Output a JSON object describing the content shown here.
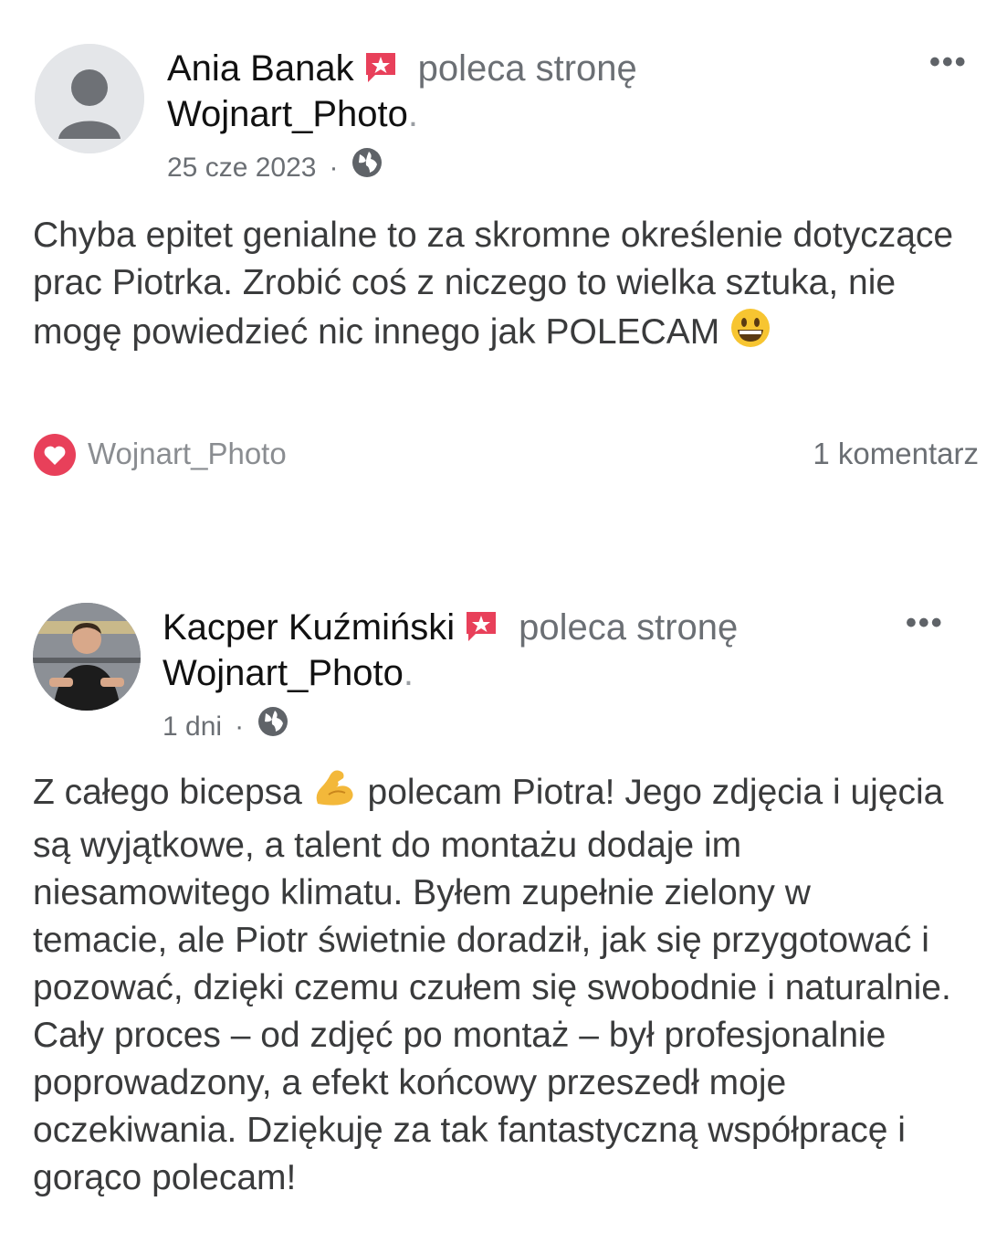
{
  "reviews": [
    {
      "author": "Ania Banak",
      "recommends_text": "poleca stronę",
      "page": "Wojnart_Photo",
      "period": ".",
      "date": "25 cze 2023",
      "separator": "·",
      "privacy_icon": "globe-icon",
      "body_before": "Chyba epitet genialne to za skromne określenie dotyczące prac Piotrka. Zrobić coś z niczego to wielka sztuka, nie mogę powiedzieć nic innego jak POLECAM",
      "body_emoji": "grinning-face-emoji",
      "reaction_page": "Wojnart_Photo",
      "comments": "1 komentarz"
    },
    {
      "author": "Kacper Kuźmiński",
      "recommends_text": "poleca stronę",
      "page": "Wojnart_Photo",
      "period": ".",
      "date": "1 dni",
      "separator": "·",
      "privacy_icon": "globe-icon",
      "body_before": "Z całego bicepsa",
      "body_emoji": "flexed-biceps-emoji",
      "body_after": "polecam Piotra! Jego zdjęcia i ujęcia są wyjątkowe, a talent do montażu dodaje im niesamowitego klimatu. Byłem zupełnie zielony w temacie, ale Piotr świetnie doradził, jak się przygotować i pozować, dzięki czemu czułem się swobodnie i naturalnie. Cały proces – od zdjęć po montaż – był profesjonalnie poprowadzony, a efekt końcowy przeszedł moje oczekiwania. Dziękuję za tak fantastyczną współpracę i gorąco polecam!"
    }
  ],
  "colors": {
    "badge": "#e8405a",
    "heart": "#e8405a",
    "muted_text": "#6b6f74",
    "avatar_placeholder": "#d4d6d9"
  }
}
